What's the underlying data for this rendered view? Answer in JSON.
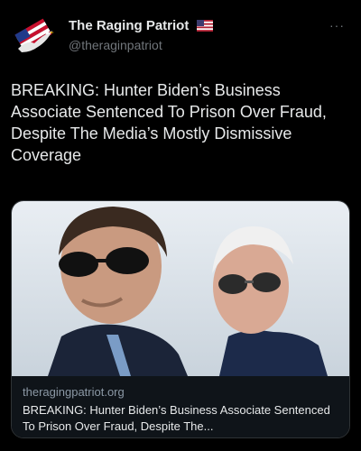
{
  "account": {
    "display_name": "The Raging Patriot",
    "handle": "@theraginpatriot",
    "badge_icon": "us-flag-icon",
    "avatar_icon": "eagle-flag-logo-icon"
  },
  "more_label": "···",
  "tweet": {
    "text": "BREAKING: Hunter Biden’s Business Associate Sentenced To Prison Over Fraud, Despite The Media’s Mostly Dismissive Coverage"
  },
  "link_card": {
    "image_icon": "news-photo",
    "domain": "theragingpatriot.org",
    "title": "BREAKING: Hunter Biden’s Business Associate Sentenced To Prison Over Fraud, Despite The..."
  },
  "colors": {
    "background": "#000000",
    "text_primary": "#e7e9ea",
    "text_secondary": "#71767b",
    "card_border": "#2f3336"
  }
}
